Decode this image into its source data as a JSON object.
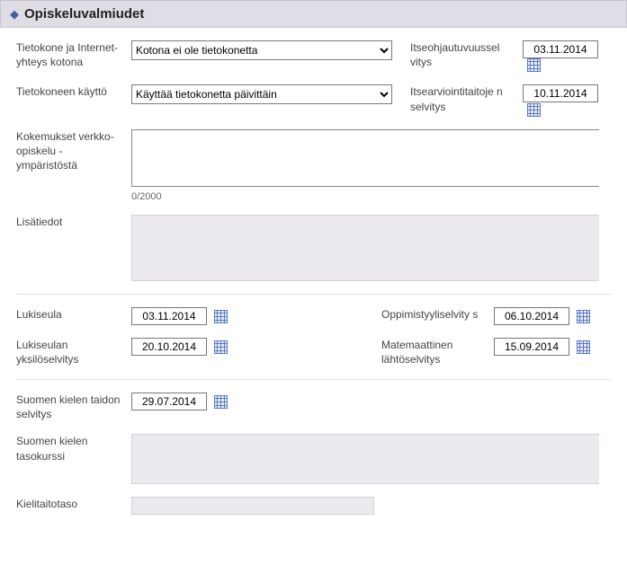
{
  "header": {
    "title": "Opiskeluvalmiudet"
  },
  "fields": {
    "computer_home_label": "Tietokone ja Internet-yhteys kotona",
    "computer_home_value": "Kotona ei ole tietokonetta",
    "computer_use_label": "Tietokoneen käyttö",
    "computer_use_value": "Käyttää tietokonetta päivittäin",
    "self_direction_label": "Itseohjautuvuussel vitys",
    "self_direction_date": "03.11.2014",
    "self_assessment_label": "Itsearviointitaitoje n selvitys",
    "self_assessment_date": "10.11.2014",
    "experience_label": "Kokemukset verkko-opiskelu -ympäristöstä",
    "experience_value": "",
    "experience_counter": "0/2000",
    "extra_label": "Lisätiedot",
    "lukiseula_label": "Lukiseula",
    "lukiseula_date": "03.11.2014",
    "lukiseula_yks_label": "Lukiseulan yksilöselvitys",
    "lukiseula_yks_date": "20.10.2014",
    "learning_style_label": "Oppimistyyliselvity s",
    "learning_style_date": "06.10.2014",
    "math_label": "Matemaattinen lähtöselvitys",
    "math_date": "15.09.2014",
    "finnish_skill_label": "Suomen kielen taidon selvitys",
    "finnish_skill_date": "29.07.2014",
    "finnish_level_label": "Suomen kielen tasokurssi",
    "language_level_label": "Kielitaitotaso"
  }
}
